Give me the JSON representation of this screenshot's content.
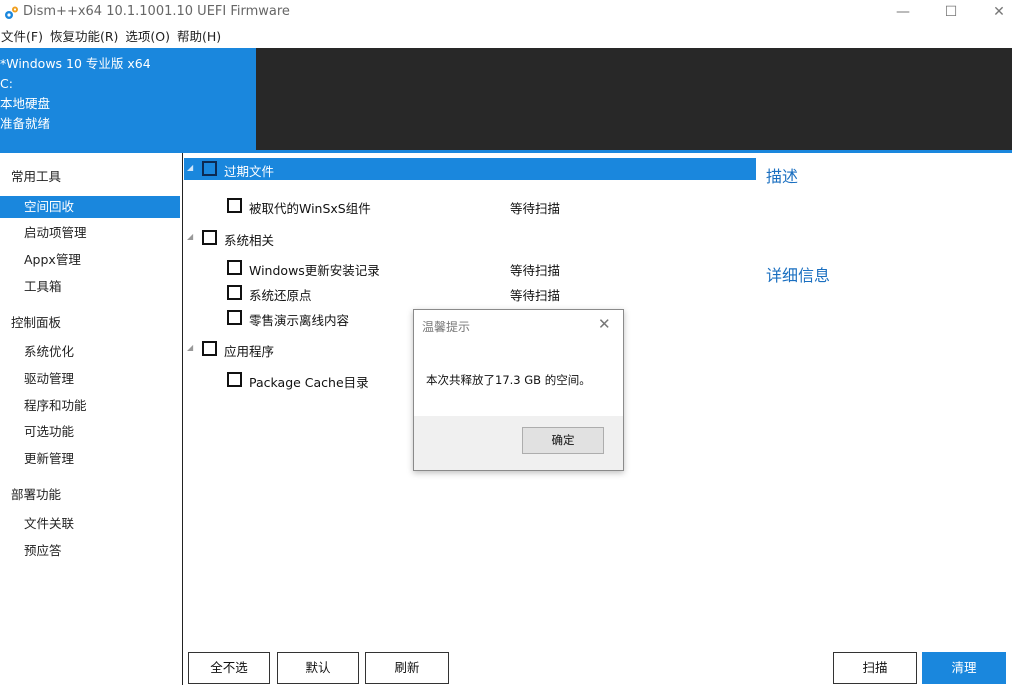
{
  "window": {
    "title": "Dism++x64 10.1.1001.10 UEFI Firmware",
    "controls": {
      "minimize": "—",
      "maximize": "☐",
      "close": "✕"
    }
  },
  "menu": [
    "文件(F)",
    "恢复功能(R)",
    "选项(O)",
    "帮助(H)"
  ],
  "system": {
    "lines": [
      "*Windows 10 专业版 x64",
      "C:",
      "本地硬盘",
      "准备就绪"
    ]
  },
  "sidebar": {
    "sections": [
      {
        "title": "常用工具",
        "items": [
          "空间回收",
          "启动项管理",
          "Appx管理",
          "工具箱"
        ]
      },
      {
        "title": "控制面板",
        "items": [
          "系统优化",
          "驱动管理",
          "程序和功能",
          "可选功能",
          "更新管理"
        ]
      },
      {
        "title": "部署功能",
        "items": [
          "文件关联",
          "预应答"
        ]
      }
    ],
    "active_item": "空间回收"
  },
  "tree": {
    "groups": [
      {
        "label": "过期文件",
        "items": [
          {
            "label": "被取代的WinSxS组件",
            "status": "等待扫描"
          }
        ]
      },
      {
        "label": "系统相关",
        "items": [
          {
            "label": "Windows更新安装记录",
            "status": "等待扫描"
          },
          {
            "label": "系统还原点",
            "status": "等待扫描"
          },
          {
            "label": "零售演示离线内容",
            "status": ""
          }
        ]
      },
      {
        "label": "应用程序",
        "items": [
          {
            "label": "Package Cache目录",
            "status": ""
          }
        ]
      }
    ]
  },
  "right_panel": {
    "description_title": "描述",
    "details_title": "详细信息"
  },
  "buttons": {
    "select_none": "全不选",
    "default": "默认",
    "refresh": "刷新",
    "scan": "扫描",
    "clean": "清理"
  },
  "dialog": {
    "title": "温馨提示",
    "close": "✕",
    "message": "本次共释放了17.3 GB 的空间。",
    "ok": "确定"
  },
  "colors": {
    "accent": "#1a87dd",
    "header_dark": "#282828",
    "heading_blue": "#1a6fc0"
  }
}
